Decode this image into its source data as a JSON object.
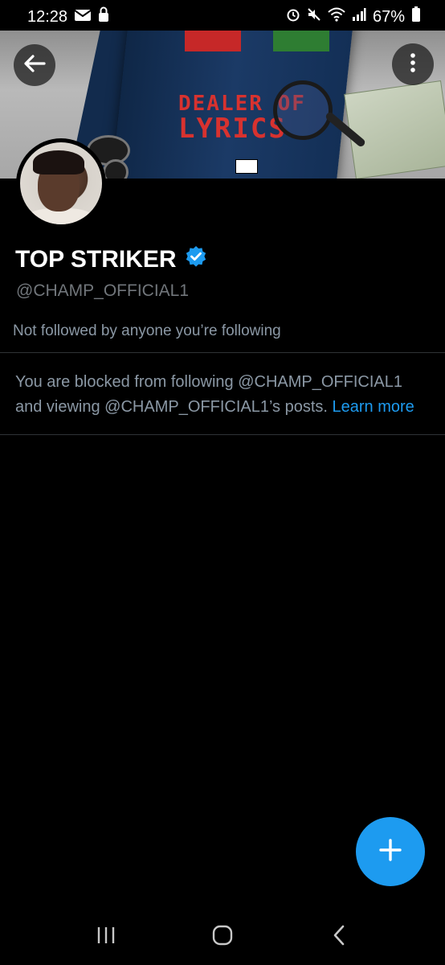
{
  "status_bar": {
    "time": "12:28",
    "battery": "67%",
    "icons_left": [
      "mail-icon",
      "lock-notification-icon"
    ],
    "icons_right": [
      "alarm-icon",
      "mute-icon",
      "wifi-icon",
      "signal-icon",
      "battery-icon"
    ]
  },
  "banner": {
    "book_title_line1": "DEALER OF",
    "book_title_line2": "LYRICS"
  },
  "header": {
    "back_icon": "back-arrow-icon",
    "more_icon": "more-vertical-icon"
  },
  "profile": {
    "display_name": "TOP STRIKER",
    "verified_icon": "verified-badge-icon",
    "handle": "@CHAMP_OFFICIAL1",
    "followed_note": "Not followed by anyone you’re following",
    "blocked_message": "You are blocked from following @CHAMP_OFFICIAL1 and viewing @CHAMP_OFFICIAL1’s posts.",
    "learn_more": "Learn more"
  },
  "fab": {
    "icon": "plus-icon"
  },
  "nav_bar": {
    "icons": [
      "recent-apps-icon",
      "home-icon",
      "back-icon"
    ]
  },
  "colors": {
    "background": "#000000",
    "accent": "#1d9bf0",
    "secondary_text": "#71767b",
    "divider": "#2f3336"
  }
}
